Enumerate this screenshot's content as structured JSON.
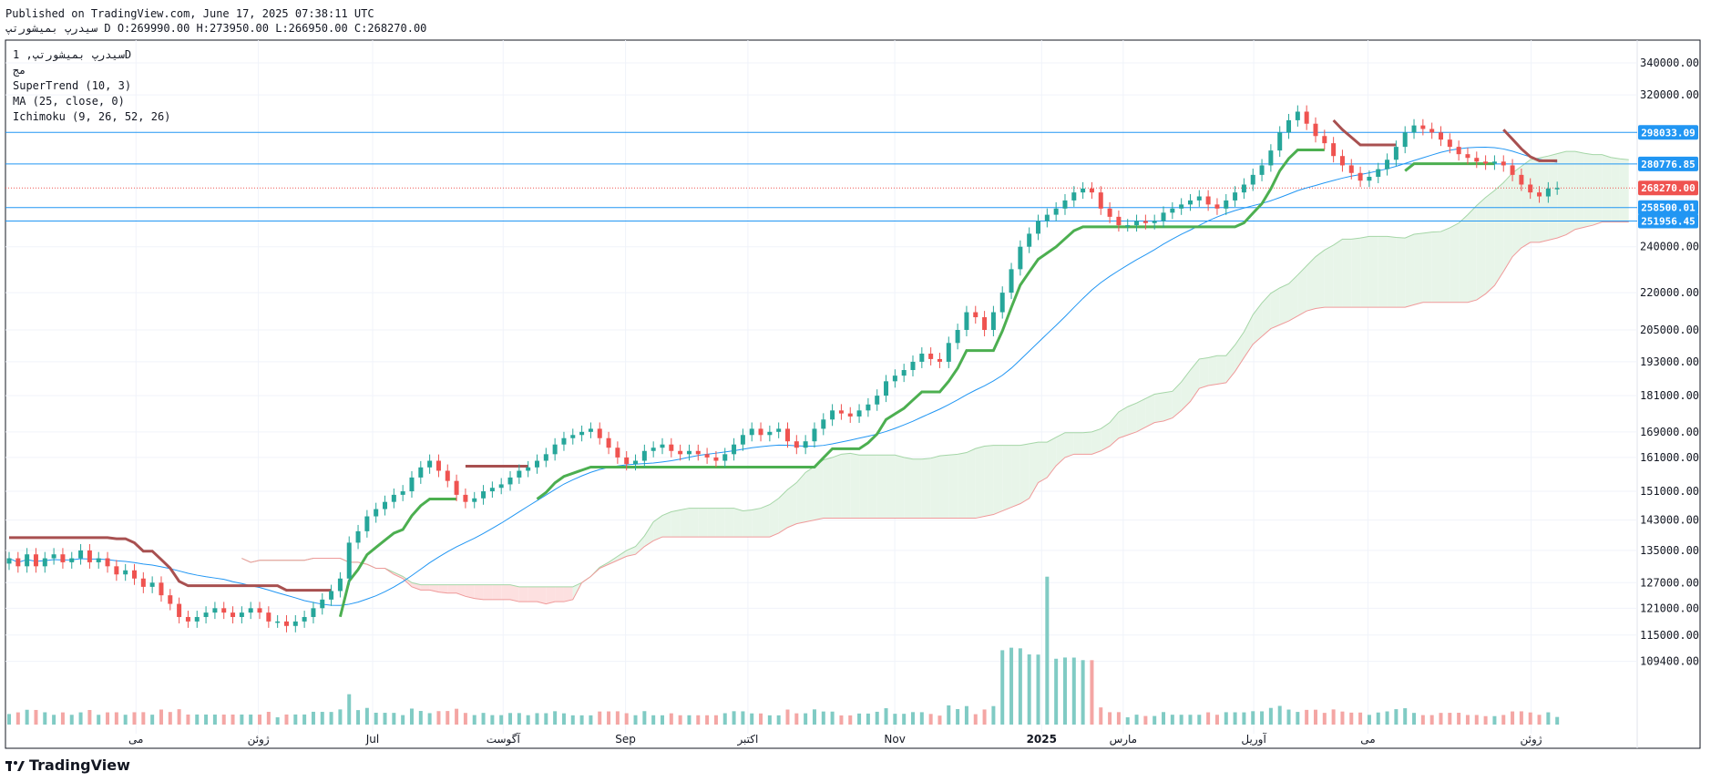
{
  "header": {
    "published": "Published on TradingView.com, June 17, 2025 07:38:11 UTC",
    "ohlc": "سیدرپ بمیشورتپ D O:269990.00 H:273950.00 L:266950.00 C:268270.00"
  },
  "legend": {
    "symbol_line": "سیدرپ بمیشورتپ, 1D",
    "sub_line": "مج",
    "indicators": [
      "SuperTrend (10, 3)",
      "MA (25, close, 0)",
      "Ichimoku (9, 26, 52, 26)"
    ]
  },
  "brand": {
    "name": "TradingView"
  },
  "colors": {
    "up": "#26a69a",
    "down": "#ef5350",
    "ma": "#2196f3",
    "supertrend_up": "#4caf50",
    "supertrend_down": "#a85050",
    "hline": "#2196f3",
    "cloud_bull": "#e8f5e9",
    "cloud_bear": "#fde0e0"
  },
  "chart_data": {
    "type": "candlestick",
    "y_axis": {
      "scale": "log",
      "ticks": [
        109400,
        115000,
        121000,
        127000,
        135000,
        143000,
        151000,
        161000,
        169000,
        181000,
        193000,
        205000,
        220000,
        240000,
        320000,
        340000
      ],
      "tick_labels": [
        "109400.00",
        "115000.00",
        "121000.00",
        "127000.00",
        "135000.00",
        "143000.00",
        "151000.00",
        "161000.00",
        "169000.00",
        "181000.00",
        "193000.00",
        "205000.00",
        "220000.00",
        "240000.00",
        "320000.00",
        "340000.00"
      ]
    },
    "x_axis": {
      "labels": [
        "می",
        "ژوئن",
        "Jul",
        "آگوست",
        "Sep",
        "اکتبر",
        "Nov",
        "2025",
        "مارس",
        "آوریل",
        "می",
        "ژوئن"
      ],
      "label_positions": [
        0.08,
        0.155,
        0.225,
        0.305,
        0.38,
        0.455,
        0.545,
        0.635,
        0.685,
        0.765,
        0.835,
        0.935
      ]
    },
    "horizontal_lines": [
      {
        "value": 298033.09,
        "label": "298033.09"
      },
      {
        "value": 280776.85,
        "label": "280776.85"
      },
      {
        "value": 258500.01,
        "label": "258500.01"
      },
      {
        "value": 251956.45,
        "label": "251956.45"
      }
    ],
    "last_price": {
      "value": 268270.0,
      "label": "268270.00"
    },
    "close_series": [
      133000,
      131000,
      134000,
      131000,
      133000,
      134000,
      132000,
      133000,
      135000,
      132000,
      133000,
      131000,
      129000,
      130000,
      128000,
      126000,
      127000,
      124000,
      122000,
      119000,
      118000,
      119000,
      120000,
      121000,
      120000,
      119000,
      120000,
      121000,
      120000,
      118000,
      118000,
      117000,
      118000,
      119000,
      121000,
      123000,
      125000,
      128000,
      137000,
      140000,
      144000,
      146000,
      148000,
      150000,
      151000,
      155000,
      158000,
      160000,
      157000,
      154000,
      150000,
      148000,
      149000,
      151000,
      152000,
      153000,
      155000,
      157000,
      158000,
      160000,
      162000,
      165000,
      167000,
      168000,
      169000,
      170000,
      167000,
      164000,
      161000,
      159000,
      160000,
      163000,
      164000,
      165000,
      163000,
      162000,
      163000,
      162000,
      161000,
      160000,
      162000,
      165000,
      168000,
      170000,
      168000,
      169000,
      170000,
      166000,
      164000,
      166000,
      170000,
      173000,
      176000,
      175000,
      174000,
      176000,
      178000,
      181000,
      186000,
      188000,
      190000,
      193000,
      196000,
      194000,
      193000,
      200000,
      205000,
      212000,
      210000,
      205000,
      212000,
      220000,
      230000,
      240000,
      246000,
      252000,
      255000,
      258000,
      262000,
      266000,
      268000,
      266000,
      258000,
      254000,
      250000,
      250000,
      252000,
      251000,
      252000,
      256000,
      258000,
      260000,
      262000,
      264000,
      260000,
      258000,
      262000,
      266000,
      270000,
      275000,
      280000,
      288000,
      298000,
      305000,
      310000,
      303000,
      296000,
      292000,
      285000,
      280000,
      276000,
      272000,
      274000,
      278000,
      283000,
      290000,
      298000,
      302000,
      300000,
      298000,
      294000,
      290000,
      286000,
      284000,
      282000,
      281000,
      282000,
      280000,
      275000,
      270000,
      266000,
      264000,
      268000,
      268270
    ]
  }
}
